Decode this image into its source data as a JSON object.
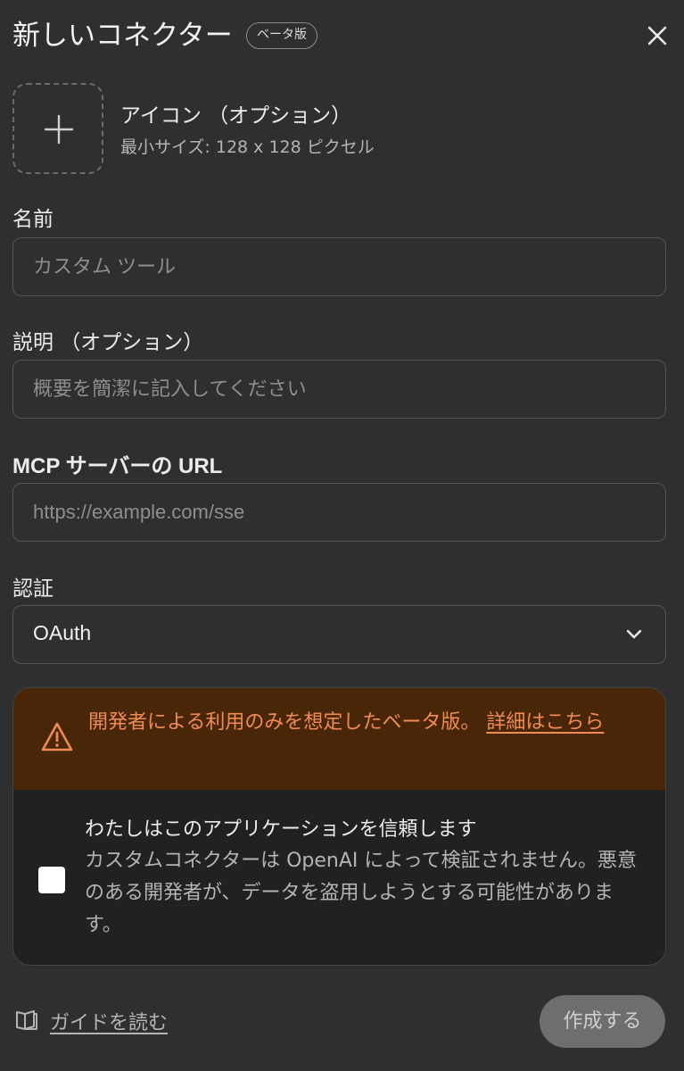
{
  "header": {
    "title": "新しいコネクター",
    "beta_badge": "ベータ版"
  },
  "icon_section": {
    "label": "アイコン （オプション）",
    "hint": "最小サイズ: 128 x 128 ピクセル"
  },
  "name_field": {
    "label": "名前",
    "placeholder": "カスタム ツール",
    "value": ""
  },
  "description_field": {
    "label": "説明 （オプション）",
    "placeholder": "概要を簡潔に記入してください",
    "value": ""
  },
  "url_field": {
    "label": "MCP サーバーの URL",
    "placeholder": "https://example.com/sse",
    "value": ""
  },
  "auth_field": {
    "label": "認証",
    "selected": "OAuth"
  },
  "warning": {
    "text": "開発者による利用のみを想定したベータ版。",
    "link": "詳細はこちら",
    "color": "#f08c53",
    "background": "#4a2608"
  },
  "trust": {
    "title": "わたしはこのアプリケーションを信頼します",
    "description": "カスタムコネクターは OpenAI によって検証されません。悪意のある開発者が、データを盗用しようとする可能性があります。",
    "checked": false
  },
  "footer": {
    "guide_link": "ガイドを読む",
    "create_button": "作成する"
  },
  "icons": [
    "close-icon",
    "plus-icon",
    "chevron-down-icon",
    "warning-icon",
    "book-icon"
  ]
}
